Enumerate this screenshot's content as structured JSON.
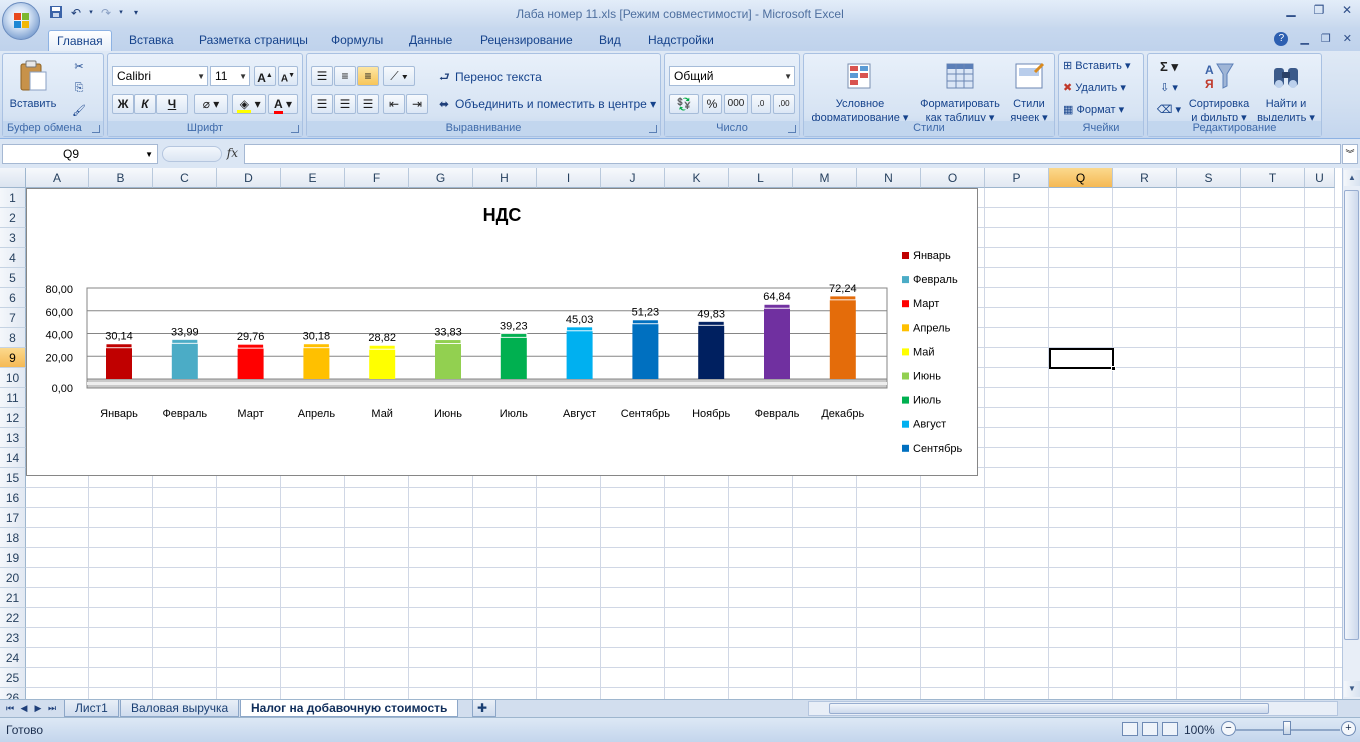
{
  "app": {
    "title": "Лаба номер 11.xls  [Режим совместимости] - Microsoft Excel",
    "min_icon": "minimize-icon",
    "max_icon": "restore-icon",
    "close_icon": "close-icon"
  },
  "ribbon_tabs": [
    "Главная",
    "Вставка",
    "Разметка страницы",
    "Формулы",
    "Данные",
    "Рецензирование",
    "Вид",
    "Надстройки"
  ],
  "ribbon": {
    "clipboard": {
      "label": "Буфер обмена",
      "paste": "Вставить"
    },
    "font": {
      "label": "Шрифт",
      "name": "Calibri",
      "size": "11",
      "bold": "Ж",
      "italic": "К",
      "underline": "Ч"
    },
    "alignment": {
      "label": "Выравнивание",
      "wrap": "Перенос текста",
      "merge": "Объединить и поместить в центре"
    },
    "number": {
      "label": "Число",
      "format": "Общий",
      "percent": "%",
      "thousands": "000",
      "inc_decimal": ",0",
      "dec_decimal": ",00"
    },
    "styles": {
      "label": "Стили",
      "cond_format_1": "Условное",
      "cond_format_2": "форматирование",
      "format_table_1": "Форматировать",
      "format_table_2": "как таблицу",
      "cell_styles_1": "Стили",
      "cell_styles_2": "ячеек"
    },
    "cells": {
      "label": "Ячейки",
      "insert": "Вставить",
      "delete": "Удалить",
      "format": "Формат"
    },
    "editing": {
      "label": "Редактирование",
      "sum": "Σ",
      "sort_1": "Сортировка",
      "sort_2": "и фильтр",
      "find_1": "Найти и",
      "find_2": "выделить"
    }
  },
  "formula_bar": {
    "name_box": "Q9",
    "fx": "fx",
    "content": ""
  },
  "columns": [
    "A",
    "B",
    "C",
    "D",
    "E",
    "F",
    "G",
    "H",
    "I",
    "J",
    "K",
    "L",
    "M",
    "N",
    "O",
    "P",
    "Q",
    "R",
    "S",
    "T",
    "U"
  ],
  "rows": [
    "1",
    "2",
    "3",
    "4",
    "5",
    "6",
    "7",
    "8",
    "9",
    "10",
    "11",
    "12",
    "13",
    "14",
    "15",
    "16",
    "17",
    "18",
    "19",
    "20",
    "21",
    "22",
    "23",
    "24",
    "25",
    "26"
  ],
  "selected_cell": "Q9",
  "chart_data": {
    "type": "bar",
    "title": "НДС",
    "categories": [
      "Январь",
      "Февраль",
      "Март",
      "Апрель",
      "Май",
      "Июнь",
      "Июль",
      "Август",
      "Сентябрь",
      "Ноябрь",
      "Февраль",
      "Декабрь"
    ],
    "values": [
      30.14,
      33.99,
      29.76,
      30.18,
      28.82,
      33.83,
      39.23,
      45.03,
      51.23,
      49.83,
      64.84,
      72.24
    ],
    "value_labels": [
      "30,14",
      "33,99",
      "29,76",
      "30,18",
      "28,82",
      "33,83",
      "39,23",
      "45,03",
      "51,23",
      "49,83",
      "64,84",
      "72,24"
    ],
    "colors": [
      "#c00000",
      "#4bacc6",
      "#ff0000",
      "#ffc000",
      "#ffff00",
      "#92d050",
      "#00b050",
      "#00b0f0",
      "#0070c0",
      "#002060",
      "#7030a0",
      "#e46c0a"
    ],
    "y_ticks": [
      "0,00",
      "20,00",
      "40,00",
      "60,00",
      "80,00"
    ],
    "ylim": [
      0,
      80
    ],
    "grid": true,
    "legend_position": "right",
    "legend": [
      "Январь",
      "Февраль",
      "Март",
      "Апрель",
      "Май",
      "Июнь",
      "Июль",
      "Август",
      "Сентябрь"
    ],
    "legend_colors": [
      "#c00000",
      "#4bacc6",
      "#ff0000",
      "#ffc000",
      "#ffff00",
      "#92d050",
      "#00b050",
      "#00b0f0",
      "#0070c0"
    ]
  },
  "sheets": [
    "Лист1",
    "Валовая выручка",
    "Налог на добавочную стоимость"
  ],
  "active_sheet": "Налог на добавочную стоимость",
  "status": {
    "ready": "Готово",
    "zoom": "100%"
  }
}
